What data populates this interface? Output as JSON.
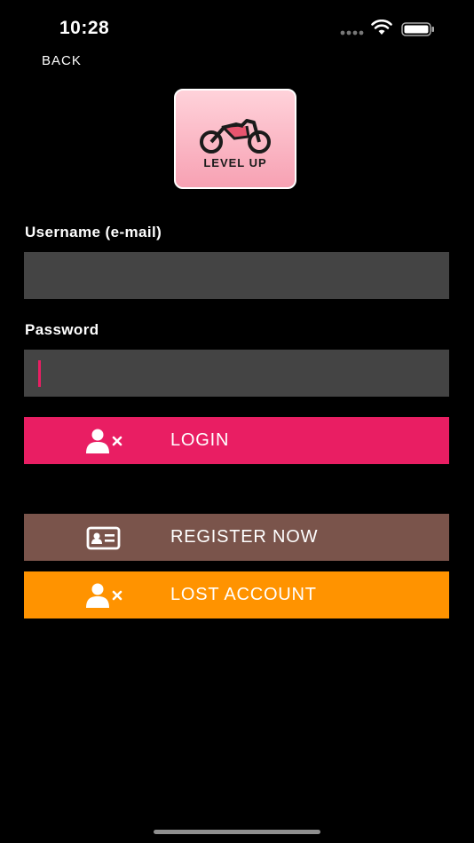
{
  "status_bar": {
    "time": "10:28"
  },
  "nav": {
    "back_label": "BACK"
  },
  "logo": {
    "text": "LEVEL UP",
    "icon": "motorcycle-icon"
  },
  "form": {
    "username_label": "Username (e-mail)",
    "username_value": "",
    "password_label": "Password",
    "password_value": ""
  },
  "buttons": {
    "login": {
      "label": "LOGIN",
      "icon": "user-x-icon",
      "color": "#e91e63"
    },
    "register": {
      "label": "REGISTER NOW",
      "icon": "id-card-icon",
      "color": "#7a544b"
    },
    "lost": {
      "label": "LOST ACCOUNT",
      "icon": "user-x-icon",
      "color": "#ff9300"
    }
  }
}
